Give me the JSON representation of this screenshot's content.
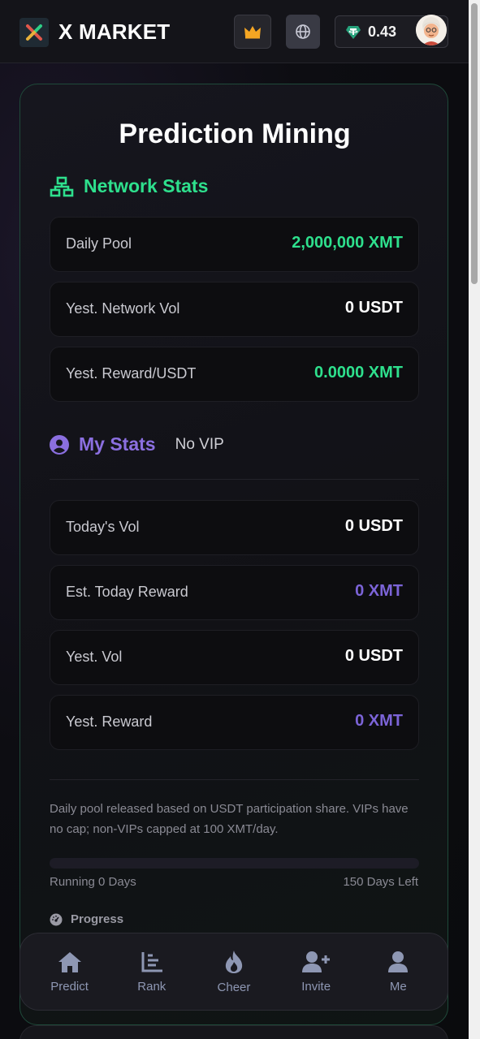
{
  "header": {
    "brand": "X MARKET",
    "balance": "0.43",
    "icons": [
      "x-logo-icon",
      "crown-icon",
      "globe-icon",
      "tether-icon",
      "avatar"
    ]
  },
  "main": {
    "title": "Prediction Mining",
    "network": {
      "heading": "Network Stats",
      "rows": [
        {
          "label": "Daily Pool",
          "value": "2,000,000 XMT"
        },
        {
          "label": "Yest. Network Vol",
          "value": "0 USDT"
        },
        {
          "label": "Yest. Reward/USDT",
          "value": "0.0000 XMT"
        }
      ]
    },
    "my": {
      "heading": "My Stats",
      "vip": "No VIP",
      "rows": [
        {
          "label": "Today's Vol",
          "value": "0 USDT"
        },
        {
          "label": "Est. Today Reward",
          "value": "0 XMT"
        },
        {
          "label": "Yest. Vol",
          "value": "0 USDT"
        },
        {
          "label": "Yest. Reward",
          "value": "0 XMT"
        }
      ]
    },
    "note": "Daily pool released based on USDT participation share. VIPs have no cap; non-VIPs capped at 100 XMT/day.",
    "progress": {
      "fraction": 0,
      "running": "Running 0 Days",
      "left": "150 Days Left",
      "label": "Progress"
    }
  },
  "nav": {
    "items": [
      {
        "label": "Predict",
        "icon": "home-icon"
      },
      {
        "label": "Rank",
        "icon": "chart-icon"
      },
      {
        "label": "Cheer",
        "icon": "fire-icon"
      },
      {
        "label": "Invite",
        "icon": "user-plus-icon"
      },
      {
        "label": "Me",
        "icon": "user-icon"
      }
    ]
  },
  "colors": {
    "accent_green": "#2ee08d",
    "accent_purple": "#7c64d8",
    "nav_icon": "#8e97b3"
  }
}
